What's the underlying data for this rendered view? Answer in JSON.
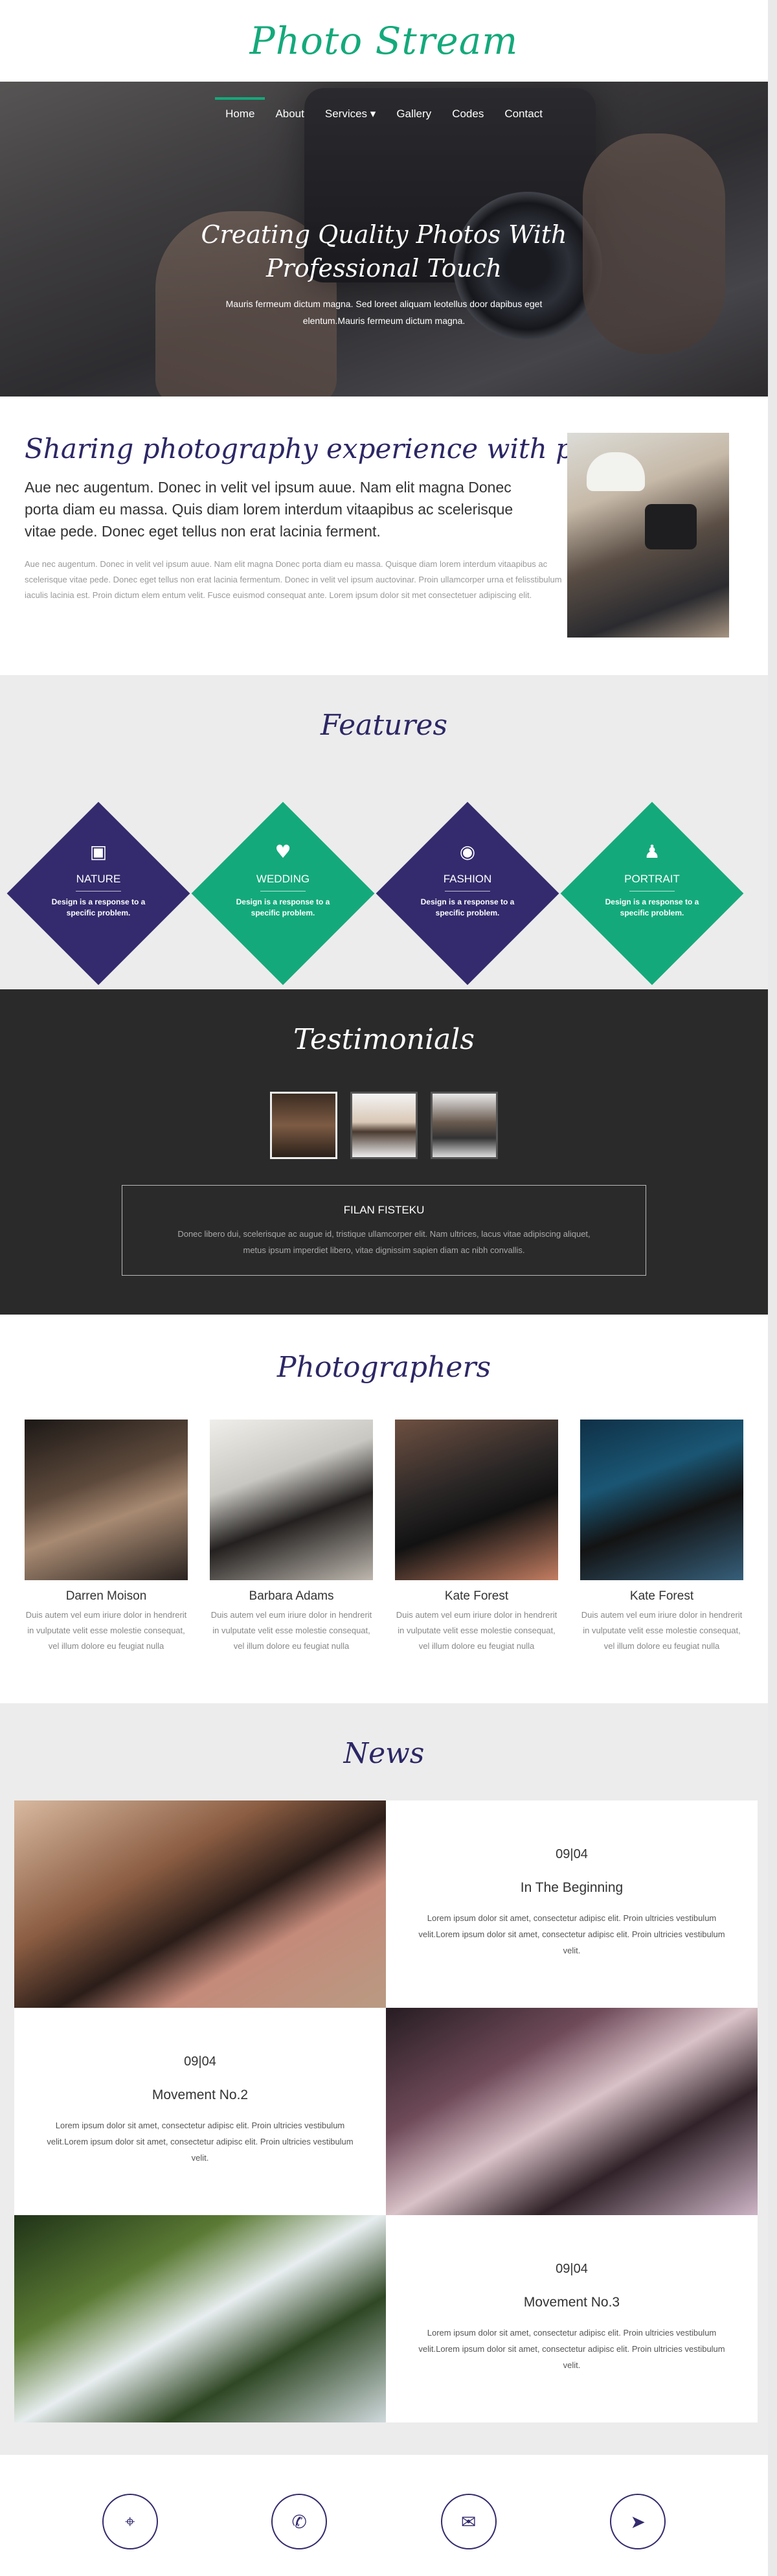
{
  "header": {
    "logo": "Photo Stream"
  },
  "nav": {
    "items": [
      {
        "label": "Home",
        "active": true
      },
      {
        "label": "About"
      },
      {
        "label": "Services ▾"
      },
      {
        "label": "Gallery"
      },
      {
        "label": "Codes"
      },
      {
        "label": "Contact"
      }
    ]
  },
  "hero": {
    "title_line1": "Creating Quality Photos With",
    "title_line2": "Professional Touch",
    "sub_line1": "Mauris fermeum dictum magna. Sed loreet aliquam leotellus door dapibus eget",
    "sub_line2": "elentum.Mauris fermeum dictum magna."
  },
  "about": {
    "heading": "Sharing photography experience with people",
    "lead": "Aue nec augentum. Donec in velit vel ipsum auue. Nam elit magna Donec porta diam eu massa. Quis diam lorem interdum vitaapibus ac scelerisque vitae pede. Donec eget tellus non erat lacinia ferment.",
    "body": "Aue nec augentum. Donec in velit vel ipsum auue. Nam elit magna Donec porta diam eu massa. Quisque diam lorem interdum vitaapibus ac scelerisque vitae pede. Donec eget tellus non erat lacinia fermentum. Donec in velit vel ipsum auctovinar. Proin ullamcorper urna et felisstibulum iaculis lacinia est. Proin dictum elem entum velit. Fusce euismod consequat ante. Lorem ipsum dolor sit met consectetuer adipiscing elit."
  },
  "features": {
    "heading": "Features",
    "items": [
      {
        "icon": "image-icon",
        "glyph": "▣",
        "title": "NATURE",
        "desc": "Design is a response to a specific problem."
      },
      {
        "icon": "heart-icon",
        "glyph": "♥",
        "title": "WEDDING",
        "desc": "Design is a response to a specific problem."
      },
      {
        "icon": "camera-icon",
        "glyph": "◉",
        "title": "FASHION",
        "desc": "Design is a response to a specific problem."
      },
      {
        "icon": "user-icon",
        "glyph": "♟",
        "title": "PORTRAIT",
        "desc": "Design is a response to a specific problem."
      }
    ]
  },
  "testimonials": {
    "heading": "Testimonials",
    "name": "FILAN FISTEKU",
    "text_line1": "Donec libero dui, scelerisque ac augue id, tristique ullamcorper elit. Nam ultrices, lacus vitae adipiscing aliquet,",
    "text_line2": "metus ipsum imperdiet libero, vitae dignissim sapien diam ac nibh convallis."
  },
  "photographers": {
    "heading": "Photographers",
    "people": [
      {
        "name": "Darren Moison",
        "desc": "Duis autem vel eum iriure dolor in hendrerit in vulputate velit esse molestie consequat, vel illum dolore eu feugiat nulla"
      },
      {
        "name": "Barbara Adams",
        "desc": "Duis autem vel eum iriure dolor in hendrerit in vulputate velit esse molestie consequat, vel illum dolore eu feugiat nulla"
      },
      {
        "name": "Kate Forest",
        "desc": "Duis autem vel eum iriure dolor in hendrerit in vulputate velit esse molestie consequat, vel illum dolore eu feugiat nulla"
      },
      {
        "name": "Kate Forest",
        "desc": "Duis autem vel eum iriure dolor in hendrerit in vulputate velit esse molestie consequat, vel illum dolore eu feugiat nulla"
      }
    ]
  },
  "news": {
    "heading": "News",
    "items": [
      {
        "date": "09|04",
        "title": "In The Beginning",
        "body": "Lorem ipsum dolor sit amet, consectetur adipisc elit. Proin ultricies vestibulum velit.Lorem ipsum dolor sit amet, consectetur adipisc elit. Proin ultricies vestibulum velit."
      },
      {
        "date": "09|04",
        "title": "Movement No.2",
        "body": "Lorem ipsum dolor sit amet, consectetur adipisc elit. Proin ultricies vestibulum velit.Lorem ipsum dolor sit amet, consectetur adipisc elit. Proin ultricies vestibulum velit."
      },
      {
        "date": "09|04",
        "title": "Movement No.3",
        "body": "Lorem ipsum dolor sit amet, consectetur adipisc elit. Proin ultricies vestibulum velit.Lorem ipsum dolor sit amet, consectetur adipisc elit. Proin ultricies vestibulum velit."
      }
    ]
  },
  "footer": {
    "icons": [
      {
        "name": "map-marker-icon",
        "glyph": "⌖"
      },
      {
        "name": "phone-icon",
        "glyph": "✆"
      },
      {
        "name": "envelope-icon",
        "glyph": "✉"
      },
      {
        "name": "paper-plane-icon",
        "glyph": "➤"
      }
    ]
  },
  "colors": {
    "brand_green": "#14a97b",
    "brand_purple": "#332b6d",
    "dark_bg": "#2b2a2b",
    "light_bg": "#ececec"
  }
}
